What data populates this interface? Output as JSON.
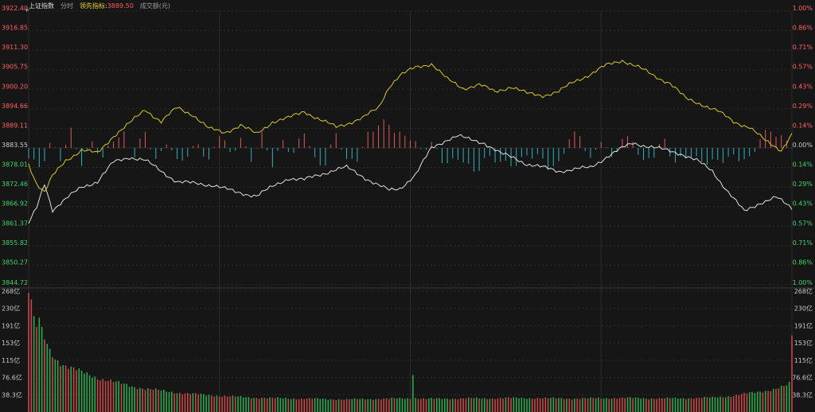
{
  "header": {
    "index_name": "上证指数",
    "period_tab": "分时",
    "lead_label": "领先指标:",
    "lead_value": "3889.50",
    "volume_label": "成交额(元)"
  },
  "colors": {
    "background": "#161616",
    "grid": "#2c2c2c",
    "up": "#e25a5a",
    "down": "#2fb3bf",
    "price_line": "#e0e0e0",
    "lead_line": "#d8c82a",
    "label_red": "#ff6060",
    "label_green": "#3fd46a",
    "vol_up": "#c84848",
    "vol_down": "#2ea84e"
  },
  "chart_data": [
    {
      "type": "line",
      "ylim": [
        3844.72,
        3922.4
      ],
      "baseline": 3883.55,
      "left_ticks": [
        "3922.40",
        "3916.85",
        "3911.30",
        "3905.75",
        "3900.20",
        "3894.66",
        "3889.11",
        "3883.55",
        "3878.01",
        "3872.46",
        "3866.92",
        "3861.37",
        "3855.82",
        "3850.27",
        "3844.72"
      ],
      "right_ticks": [
        "1.00%",
        "0.86%",
        "0.71%",
        "0.57%",
        "0.43%",
        "0.29%",
        "0.14%",
        "0.00%",
        "0.14%",
        "0.29%",
        "0.43%",
        "0.57%",
        "0.71%",
        "0.86%",
        "1.00%"
      ],
      "x_count": 241,
      "series": [
        {
          "role": "price",
          "anchors": [
            [
              0,
              3862.0
            ],
            [
              3,
              3866.5
            ],
            [
              6,
              3873.5
            ],
            [
              9,
              3866.0
            ],
            [
              14,
              3869.0
            ],
            [
              20,
              3872.5
            ],
            [
              26,
              3874.0
            ],
            [
              32,
              3879.5
            ],
            [
              38,
              3881.0
            ],
            [
              44,
              3880.0
            ],
            [
              50,
              3877.0
            ],
            [
              56,
              3874.0
            ],
            [
              62,
              3873.5
            ],
            [
              70,
              3873.0
            ],
            [
              78,
              3871.0
            ],
            [
              86,
              3870.0
            ],
            [
              92,
              3872.5
            ],
            [
              98,
              3875.0
            ],
            [
              104,
              3874.5
            ],
            [
              110,
              3876.0
            ],
            [
              116,
              3877.5
            ],
            [
              120,
              3878.0
            ],
            [
              126,
              3875.5
            ],
            [
              132,
              3873.0
            ],
            [
              136,
              3871.5
            ],
            [
              140,
              3872.0
            ],
            [
              146,
              3876.0
            ],
            [
              152,
              3883.5
            ],
            [
              158,
              3886.0
            ],
            [
              162,
              3887.0
            ],
            [
              166,
              3886.0
            ],
            [
              172,
              3885.0
            ],
            [
              178,
              3882.0
            ],
            [
              184,
              3880.5
            ],
            [
              188,
              3879.0
            ],
            [
              194,
              3878.0
            ],
            [
              200,
              3877.0
            ],
            [
              206,
              3877.5
            ],
            [
              212,
              3878.0
            ],
            [
              218,
              3881.0
            ],
            [
              224,
              3883.5
            ],
            [
              228,
              3885.0
            ],
            [
              234,
              3884.0
            ],
            [
              240,
              3883.0
            ],
            [
              246,
              3882.0
            ],
            [
              252,
              3880.0
            ],
            [
              258,
              3877.0
            ],
            [
              264,
              3871.0
            ],
            [
              270,
              3865.5
            ],
            [
              276,
              3868.0
            ],
            [
              282,
              3869.5
            ],
            [
              288,
              3866.5
            ]
          ]
        },
        {
          "role": "lead",
          "anchors": [
            [
              0,
              3879.0
            ],
            [
              3,
              3873.5
            ],
            [
              6,
              3871.0
            ],
            [
              9,
              3875.5
            ],
            [
              14,
              3880.0
            ],
            [
              20,
              3883.0
            ],
            [
              26,
              3882.0
            ],
            [
              32,
              3887.0
            ],
            [
              38,
              3890.5
            ],
            [
              44,
              3894.5
            ],
            [
              50,
              3891.0
            ],
            [
              56,
              3895.0
            ],
            [
              62,
              3893.0
            ],
            [
              68,
              3889.0
            ],
            [
              74,
              3888.0
            ],
            [
              80,
              3890.0
            ],
            [
              86,
              3887.5
            ],
            [
              92,
              3891.0
            ],
            [
              98,
              3892.0
            ],
            [
              104,
              3894.0
            ],
            [
              110,
              3891.5
            ],
            [
              116,
              3889.5
            ],
            [
              120,
              3890.5
            ],
            [
              126,
              3892.0
            ],
            [
              132,
              3895.0
            ],
            [
              136,
              3901.0
            ],
            [
              140,
              3904.0
            ],
            [
              146,
              3906.5
            ],
            [
              152,
              3907.5
            ],
            [
              158,
              3903.0
            ],
            [
              164,
              3900.5
            ],
            [
              170,
              3901.5
            ],
            [
              176,
              3899.5
            ],
            [
              182,
              3901.0
            ],
            [
              188,
              3899.0
            ],
            [
              194,
              3898.5
            ],
            [
              200,
              3899.5
            ],
            [
              206,
              3902.5
            ],
            [
              212,
              3904.5
            ],
            [
              218,
              3907.0
            ],
            [
              224,
              3908.5
            ],
            [
              230,
              3906.5
            ],
            [
              236,
              3904.0
            ],
            [
              242,
              3902.0
            ],
            [
              248,
              3897.5
            ],
            [
              254,
              3896.0
            ],
            [
              260,
              3894.0
            ],
            [
              266,
              3891.0
            ],
            [
              272,
              3889.5
            ],
            [
              278,
              3885.5
            ],
            [
              284,
              3883.0
            ],
            [
              288,
              3887.5
            ]
          ]
        }
      ],
      "bar_anchors": [
        [
          0,
          -3.0
        ],
        [
          4,
          -5.5
        ],
        [
          8,
          2.0
        ],
        [
          12,
          -4.0
        ],
        [
          16,
          4.5
        ],
        [
          20,
          -3.5
        ],
        [
          24,
          2.0
        ],
        [
          28,
          -4.5
        ],
        [
          32,
          3.0
        ],
        [
          36,
          5.0
        ],
        [
          40,
          -2.5
        ],
        [
          44,
          4.0
        ],
        [
          48,
          -3.5
        ],
        [
          52,
          3.0
        ],
        [
          56,
          -5.0
        ],
        [
          60,
          -3.0
        ],
        [
          64,
          2.5
        ],
        [
          68,
          -4.0
        ],
        [
          72,
          3.5
        ],
        [
          76,
          -2.0
        ],
        [
          80,
          4.0
        ],
        [
          84,
          -3.5
        ],
        [
          88,
          2.5
        ],
        [
          92,
          -4.5
        ],
        [
          96,
          3.0
        ],
        [
          100,
          -2.5
        ],
        [
          104,
          4.5
        ],
        [
          108,
          -3.0
        ],
        [
          112,
          -4.0
        ],
        [
          116,
          3.5
        ],
        [
          120,
          -4.5
        ],
        [
          124,
          -2.0
        ],
        [
          128,
          4.0
        ],
        [
          132,
          6.0
        ],
        [
          136,
          7.5
        ],
        [
          140,
          5.0
        ],
        [
          144,
          3.0
        ],
        [
          148,
          -2.0
        ],
        [
          152,
          2.5
        ],
        [
          156,
          -3.0
        ],
        [
          160,
          -5.0
        ],
        [
          164,
          -4.0
        ],
        [
          168,
          -6.5
        ],
        [
          172,
          -3.0
        ],
        [
          176,
          -4.5
        ],
        [
          180,
          -5.0
        ],
        [
          184,
          -3.5
        ],
        [
          188,
          -2.5
        ],
        [
          192,
          -3.5
        ],
        [
          196,
          -5.0
        ],
        [
          200,
          -4.0
        ],
        [
          204,
          2.5
        ],
        [
          208,
          3.0
        ],
        [
          212,
          -3.0
        ],
        [
          216,
          3.5
        ],
        [
          220,
          -4.5
        ],
        [
          224,
          2.5
        ],
        [
          228,
          3.5
        ],
        [
          232,
          -4.5
        ],
        [
          236,
          -3.0
        ],
        [
          240,
          2.5
        ],
        [
          244,
          -3.5
        ],
        [
          248,
          -2.5
        ],
        [
          252,
          -4.5
        ],
        [
          256,
          -3.5
        ],
        [
          260,
          -3.0
        ],
        [
          264,
          -4.0
        ],
        [
          268,
          -3.5
        ],
        [
          272,
          -2.5
        ],
        [
          276,
          3.5
        ],
        [
          280,
          4.0
        ],
        [
          284,
          3.0
        ],
        [
          288,
          2.0
        ]
      ]
    },
    {
      "type": "bar",
      "ylim": [
        0,
        268
      ],
      "left_ticks": [
        "268亿",
        "230亿",
        "191亿",
        "153亿",
        "115亿",
        "76.6亿",
        "38.3亿"
      ],
      "right_ticks": [
        "268亿",
        "230亿",
        "191亿",
        "153亿",
        "115亿",
        "76.6亿",
        "38.3亿"
      ],
      "volume_anchors": [
        [
          0,
          268
        ],
        [
          1,
          255
        ],
        [
          2,
          200
        ],
        [
          3,
          185
        ],
        [
          4,
          205
        ],
        [
          5,
          175
        ],
        [
          6,
          160
        ],
        [
          7,
          150
        ],
        [
          8,
          135
        ],
        [
          10,
          120
        ],
        [
          12,
          110
        ],
        [
          14,
          103
        ],
        [
          17,
          95
        ],
        [
          20,
          88
        ],
        [
          24,
          80
        ],
        [
          28,
          73
        ],
        [
          32,
          67
        ],
        [
          36,
          61
        ],
        [
          40,
          56
        ],
        [
          45,
          51
        ],
        [
          50,
          47
        ],
        [
          55,
          44
        ],
        [
          60,
          41
        ],
        [
          66,
          38
        ],
        [
          72,
          36
        ],
        [
          80,
          33
        ],
        [
          90,
          31
        ],
        [
          100,
          30
        ],
        [
          110,
          29
        ],
        [
          120,
          28
        ],
        [
          130,
          29
        ],
        [
          140,
          30
        ],
        [
          146,
          31
        ],
        [
          150,
          29
        ],
        [
          160,
          30
        ],
        [
          170,
          30
        ],
        [
          180,
          31
        ],
        [
          190,
          31
        ],
        [
          200,
          30
        ],
        [
          210,
          30
        ],
        [
          220,
          31
        ],
        [
          230,
          31
        ],
        [
          240,
          30
        ],
        [
          250,
          31
        ],
        [
          258,
          32
        ],
        [
          264,
          35
        ],
        [
          270,
          40
        ],
        [
          276,
          45
        ],
        [
          282,
          52
        ],
        [
          286,
          58
        ],
        [
          287,
          62
        ]
      ],
      "volume_spikes": [
        [
          145,
          82
        ],
        [
          288,
          170
        ]
      ]
    }
  ]
}
